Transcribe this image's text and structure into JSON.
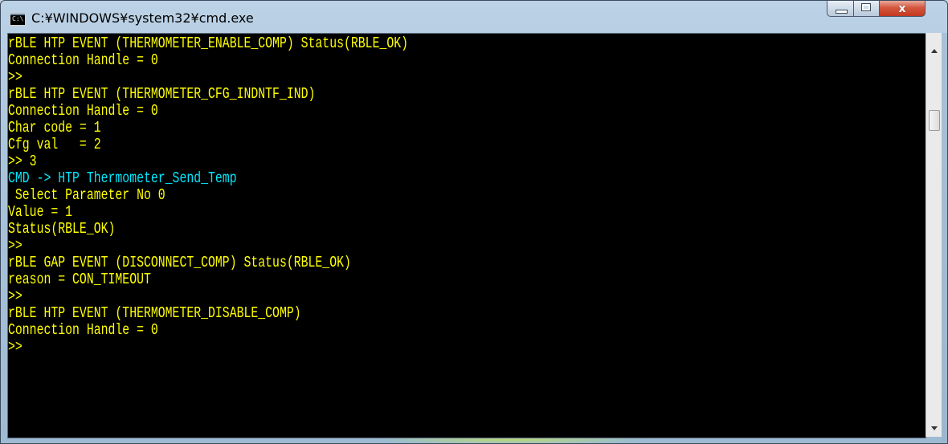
{
  "window": {
    "title": "C:¥WINDOWS¥system32¥cmd.exe",
    "icon_text": "C:\\",
    "controls": {
      "minimize": "minimize",
      "maximize": "maximize",
      "close": "x"
    }
  },
  "console": {
    "colors": {
      "background": "#000000",
      "yellow": "#ffff00",
      "cyan": "#00e8ff"
    },
    "lines": [
      {
        "text": "rBLE HTP EVENT (THERMOMETER_ENABLE_COMP) Status(RBLE_OK)",
        "color": "yellow"
      },
      {
        "text": "Connection Handle = 0",
        "color": "yellow"
      },
      {
        "text": ">>",
        "color": "yellow"
      },
      {
        "text": "rBLE HTP EVENT (THERMOMETER_CFG_INDNTF_IND)",
        "color": "yellow"
      },
      {
        "text": "Connection Handle = 0",
        "color": "yellow"
      },
      {
        "text": "Char code = 1",
        "color": "yellow"
      },
      {
        "text": "Cfg val   = 2",
        "color": "yellow"
      },
      {
        "text": ">> 3",
        "color": "yellow"
      },
      {
        "text": "CMD -> HTP Thermometer_Send_Temp",
        "color": "cyan"
      },
      {
        "text": " Select Parameter No 0",
        "color": "yellow"
      },
      {
        "text": "Value = 1",
        "color": "yellow"
      },
      {
        "text": "Status(RBLE_OK)",
        "color": "yellow"
      },
      {
        "text": ">>",
        "color": "yellow"
      },
      {
        "text": "rBLE GAP EVENT (DISCONNECT_COMP) Status(RBLE_OK)",
        "color": "yellow"
      },
      {
        "text": "reason = CON_TIMEOUT",
        "color": "yellow"
      },
      {
        "text": ">>",
        "color": "yellow"
      },
      {
        "text": "rBLE HTP EVENT (THERMOMETER_DISABLE_COMP)",
        "color": "yellow"
      },
      {
        "text": "Connection Handle = 0",
        "color": "yellow"
      },
      {
        "text": ">>",
        "color": "yellow"
      }
    ]
  },
  "scrollbar": {
    "up_icon": "triangle-up-icon",
    "down_icon": "triangle-down-icon"
  }
}
